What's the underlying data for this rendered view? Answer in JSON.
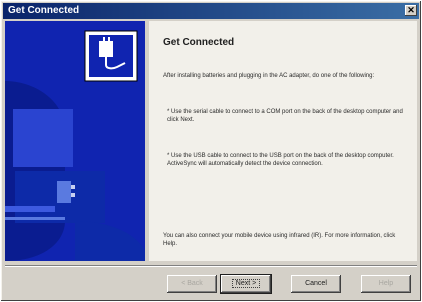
{
  "window": {
    "title": "Get Connected",
    "close_glyph": "✕"
  },
  "content": {
    "heading": "Get Connected",
    "para1": "After installing batteries and plugging in the AC adapter, do one of the following:",
    "para2": "* Use the serial cable to connect to a COM port on the back of the desktop computer and click Next.",
    "para3": "* Use the USB cable to connect to the USB port on the back of the desktop computer. ActiveSync will automatically detect the device connection.",
    "para4": "You can also connect your mobile device using infrared (IR). For more information, click Help."
  },
  "buttons": {
    "back": "< Back",
    "next": "Next >",
    "cancel": "Cancel",
    "help": "Help"
  },
  "icons": {
    "side": "device-plug-icon",
    "close": "close-icon"
  },
  "colors": {
    "titlebar": "#0a246a",
    "side_panel": "#1024b0",
    "window": "#d4d0c8"
  }
}
